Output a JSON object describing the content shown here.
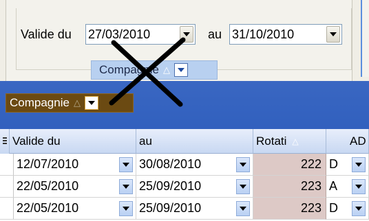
{
  "filter": {
    "valid_from_label": "Valide du",
    "valid_from_value": "27/03/2010",
    "valid_to_label": "au",
    "valid_to_value": "31/10/2010"
  },
  "floating_chip": {
    "label": "Compagnie",
    "sort_glyph": "△"
  },
  "group_bar": {
    "chip": {
      "label": "Compagnie",
      "sort_glyph": "△"
    }
  },
  "grid": {
    "columns": [
      {
        "label": "Valide du"
      },
      {
        "label": "au"
      },
      {
        "label": "Rotati",
        "sort_glyph": "△"
      },
      {
        "label": "AD"
      }
    ],
    "rows": [
      {
        "valide_du": "12/07/2010",
        "au": "30/08/2010",
        "rotation": "222",
        "ad": "D"
      },
      {
        "valide_du": "22/05/2010",
        "au": "25/09/2010",
        "rotation": "223",
        "ad": "A"
      },
      {
        "valide_du": "22/05/2010",
        "au": "25/09/2010",
        "rotation": "223",
        "ad": "D"
      }
    ]
  },
  "colors": {
    "group_bar": "#3160be",
    "docked_chip": "#6b4a12",
    "floating_chip": "#b8d0f0",
    "rotation_cell": "#ddc9c6",
    "x_mark": "#000000"
  }
}
